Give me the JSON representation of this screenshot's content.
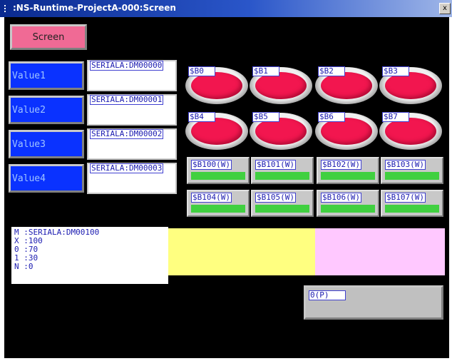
{
  "window": {
    "title": ":NS-Runtime-ProjectA-000:Screen",
    "close_glyph": "x"
  },
  "screen_button": {
    "label": "Screen"
  },
  "values": [
    {
      "label": "Value1",
      "address": "SERIALA:DM00000"
    },
    {
      "label": "Value2",
      "address": "SERIALA:DM00001"
    },
    {
      "label": "Value3",
      "address": "SERIALA:DM00002"
    },
    {
      "label": "Value4",
      "address": "SERIALA:DM00003"
    }
  ],
  "lamps": [
    {
      "label": "$B0"
    },
    {
      "label": "$B1"
    },
    {
      "label": "$B2"
    },
    {
      "label": "$B3"
    },
    {
      "label": "$B4"
    },
    {
      "label": "$B5"
    },
    {
      "label": "$B6"
    },
    {
      "label": "$B7"
    }
  ],
  "bit_lamps": [
    {
      "label": "$B100(W)"
    },
    {
      "label": "$B101(W)"
    },
    {
      "label": "$B102(W)"
    },
    {
      "label": "$B103(W)"
    },
    {
      "label": "$B104(W)"
    },
    {
      "label": "$B105(W)"
    },
    {
      "label": "$B106(W)"
    },
    {
      "label": "$B107(W)"
    }
  ],
  "info_lines": {
    "m": "M :SERIALA:DM00100",
    "x": "X :100",
    "o": "0 :70",
    "i": "1 :30",
    "n": "N :0"
  },
  "gray_button": {
    "label": "0(P)"
  },
  "colors": {
    "screen_bg": "#000000",
    "screen_button": "#f06a95",
    "value_button": "#0a32ff",
    "lamp_on": "#f2164f",
    "bit_lamp_bar": "#40d040",
    "yellow_area": "#ffff80",
    "pink_area": "#ffc8ff",
    "gray_button": "#c0c0c0"
  }
}
